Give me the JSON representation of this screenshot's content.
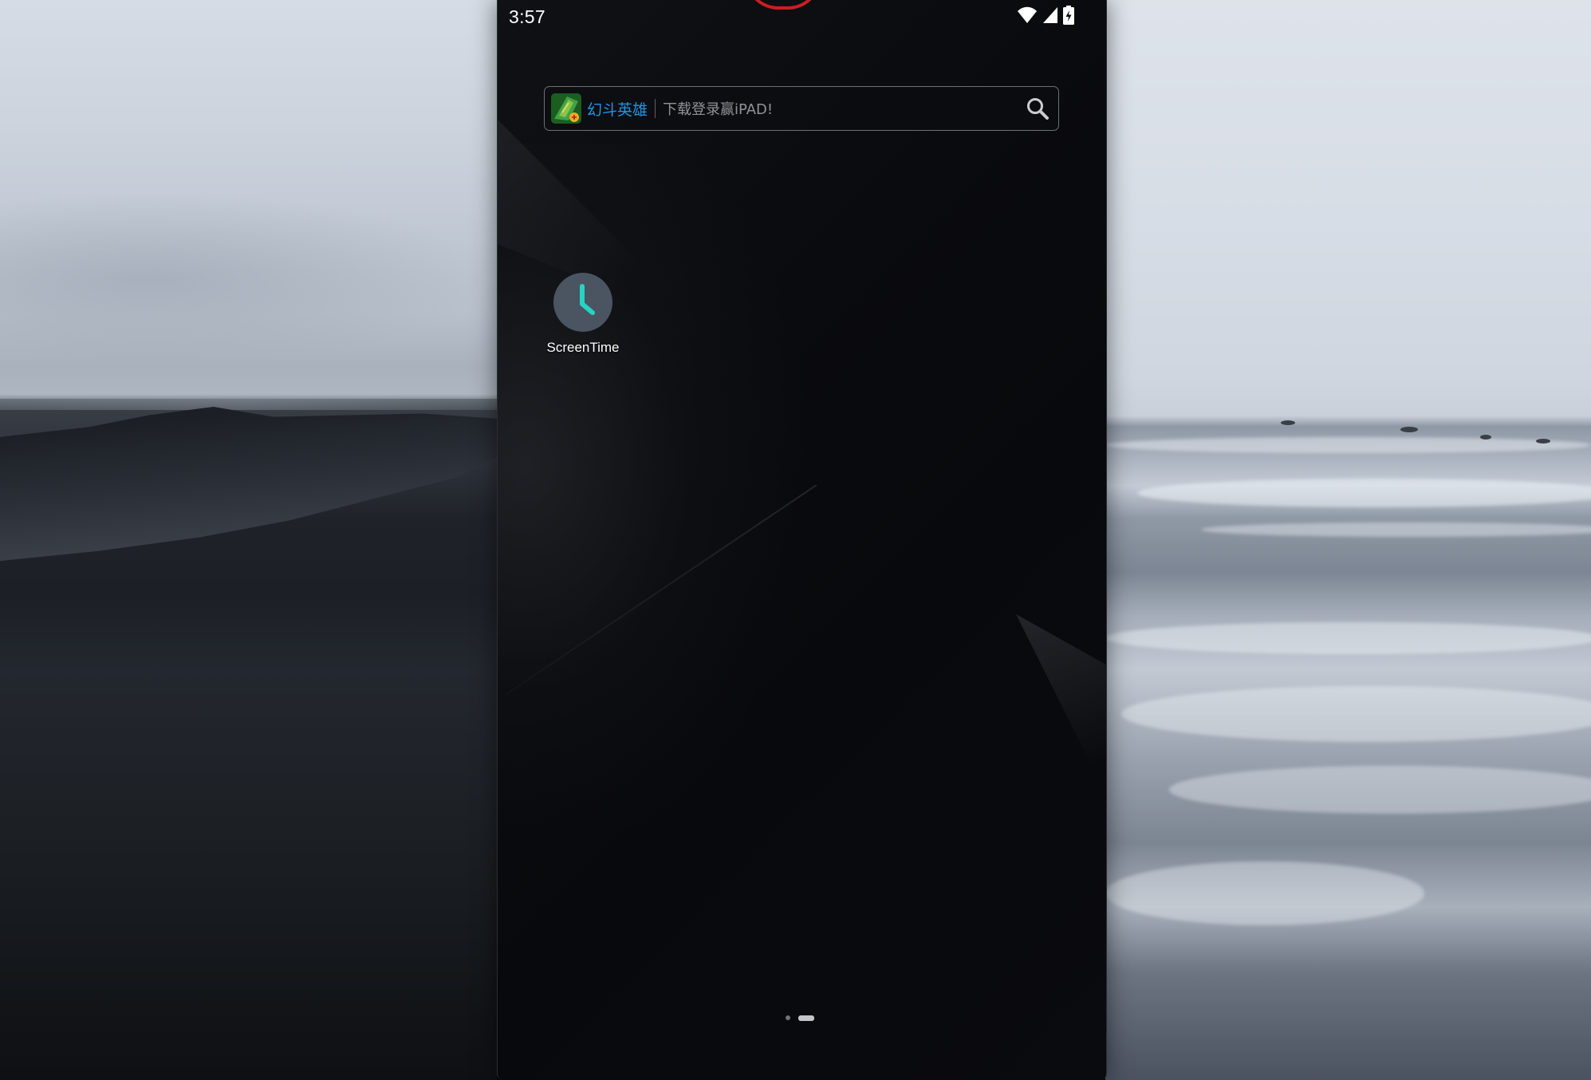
{
  "status_bar": {
    "time": "3:57",
    "icons": [
      "wifi-icon",
      "cellular-signal-icon",
      "battery-charging-icon"
    ],
    "record_indicator_color": "#c8201f"
  },
  "search_widget": {
    "ad_icon": "game-ad-icon",
    "brand": "幻斗英雄",
    "hint": "下载登录赢iPAD!",
    "brand_color": "#1e96e6",
    "search_icon": "search-icon"
  },
  "apps": [
    {
      "label": "ScreenTime",
      "icon": "clock-icon",
      "icon_bg": "#4b5561",
      "accent": "#27d3c3"
    }
  ],
  "page_indicator": {
    "pages": 2,
    "current": 2
  }
}
